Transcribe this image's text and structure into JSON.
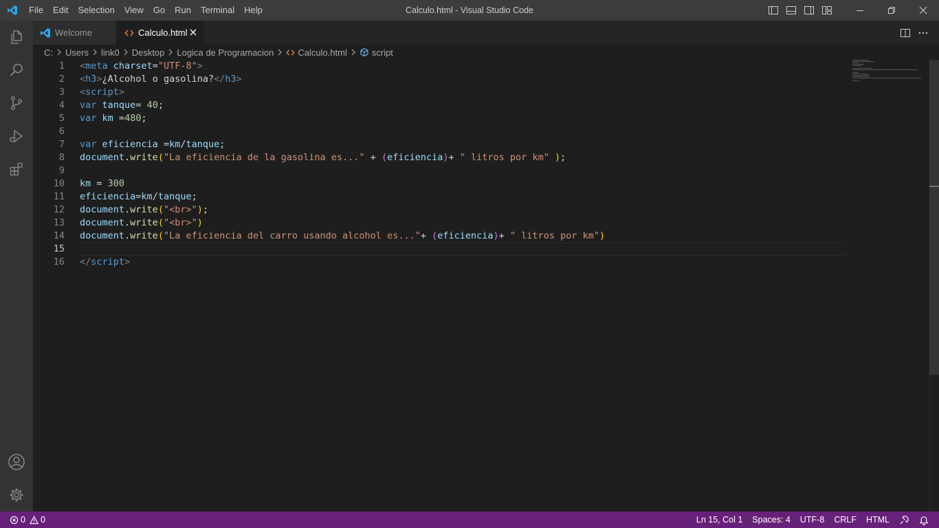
{
  "window": {
    "title": "Calculo.html - Visual Studio Code",
    "menu": [
      "File",
      "Edit",
      "Selection",
      "View",
      "Go",
      "Run",
      "Terminal",
      "Help"
    ]
  },
  "tabs": [
    {
      "label": "Welcome",
      "icon": "vscode-logo-icon",
      "active": false
    },
    {
      "label": "Calculo.html",
      "icon": "html-file-icon",
      "active": true
    }
  ],
  "breadcrumb": [
    "C:",
    "Users",
    "link0",
    "Desktop",
    "Logica de Programacion",
    "Calculo.html",
    "script"
  ],
  "editor": {
    "current_line": 15,
    "line_numbers": [
      "1",
      "2",
      "3",
      "4",
      "5",
      "6",
      "7",
      "8",
      "9",
      "10",
      "11",
      "12",
      "13",
      "14",
      "15",
      "16"
    ]
  },
  "statusbar": {
    "errors": "0",
    "warnings": "0",
    "position": "Ln 15, Col 1",
    "spaces": "Spaces: 4",
    "encoding": "UTF-8",
    "eol": "CRLF",
    "language": "HTML"
  },
  "colors": {
    "statusbar_bg": "#68217a",
    "titlebar_bg": "#3c3c3c",
    "activitybar_bg": "#333333",
    "editor_bg": "#1e1e1e",
    "accent_blue": "#007acc"
  },
  "code_lines": [
    [
      [
        "t-tag",
        "<"
      ],
      [
        "t-tname",
        "meta"
      ],
      [
        "t-text",
        " "
      ],
      [
        "t-attr",
        "charset"
      ],
      [
        "t-text",
        "="
      ],
      [
        "t-str",
        "\"UTF-8\""
      ],
      [
        "t-tag",
        ">"
      ]
    ],
    [
      [
        "t-tag",
        "<"
      ],
      [
        "t-tname",
        "h3"
      ],
      [
        "t-tag",
        ">"
      ],
      [
        "t-text",
        "¿Alcohol o gasolina?"
      ],
      [
        "t-tag",
        "</"
      ],
      [
        "t-tname",
        "h3"
      ],
      [
        "t-tag",
        ">"
      ]
    ],
    [
      [
        "t-tag",
        "<"
      ],
      [
        "t-tname",
        "script"
      ],
      [
        "t-tag",
        ">"
      ]
    ],
    [
      [
        "t-kw",
        "var"
      ],
      [
        "t-text",
        " "
      ],
      [
        "t-var",
        "tanque"
      ],
      [
        "t-text",
        "= "
      ],
      [
        "t-num",
        "40"
      ],
      [
        "t-text",
        ";"
      ]
    ],
    [
      [
        "t-kw",
        "var"
      ],
      [
        "t-text",
        " "
      ],
      [
        "t-var",
        "km"
      ],
      [
        "t-text",
        " ="
      ],
      [
        "t-num",
        "480"
      ],
      [
        "t-text",
        ";"
      ]
    ],
    [],
    [
      [
        "t-kw",
        "var"
      ],
      [
        "t-text",
        " "
      ],
      [
        "t-var",
        "eficiencia"
      ],
      [
        "t-text",
        " ="
      ],
      [
        "t-var",
        "km"
      ],
      [
        "t-text",
        "/"
      ],
      [
        "t-var",
        "tanque"
      ],
      [
        "t-text",
        ";"
      ]
    ],
    [
      [
        "t-var",
        "document"
      ],
      [
        "t-text",
        "."
      ],
      [
        "t-fn",
        "write"
      ],
      [
        "t-p1",
        "("
      ],
      [
        "t-str",
        "\"La eficiencia de la gasolina es...\""
      ],
      [
        "t-text",
        " + "
      ],
      [
        "t-p2",
        "("
      ],
      [
        "t-var",
        "eficiencia"
      ],
      [
        "t-p2",
        ")"
      ],
      [
        "t-text",
        "+ "
      ],
      [
        "t-str",
        "\" litros por km\""
      ],
      [
        "t-text",
        " "
      ],
      [
        "t-p1",
        ")"
      ],
      [
        "t-text",
        ";"
      ]
    ],
    [],
    [
      [
        "t-var",
        "km"
      ],
      [
        "t-text",
        " = "
      ],
      [
        "t-num",
        "300"
      ]
    ],
    [
      [
        "t-var",
        "eficiencia"
      ],
      [
        "t-text",
        "="
      ],
      [
        "t-var",
        "km"
      ],
      [
        "t-text",
        "/"
      ],
      [
        "t-var",
        "tanque"
      ],
      [
        "t-text",
        ";"
      ]
    ],
    [
      [
        "t-var",
        "document"
      ],
      [
        "t-text",
        "."
      ],
      [
        "t-fn",
        "write"
      ],
      [
        "t-p1",
        "("
      ],
      [
        "t-str",
        "\"<br>\""
      ],
      [
        "t-p1",
        ")"
      ],
      [
        "t-text",
        ";"
      ]
    ],
    [
      [
        "t-var",
        "document"
      ],
      [
        "t-text",
        "."
      ],
      [
        "t-fn",
        "write"
      ],
      [
        "t-p1",
        "("
      ],
      [
        "t-str",
        "\"<br>\""
      ],
      [
        "t-p1",
        ")"
      ]
    ],
    [
      [
        "t-var",
        "document"
      ],
      [
        "t-text",
        "."
      ],
      [
        "t-fn",
        "write"
      ],
      [
        "t-p1",
        "("
      ],
      [
        "t-str",
        "\"La eficiencia del carro usando alcohol es...\""
      ],
      [
        "t-text",
        "+ "
      ],
      [
        "t-p2",
        "("
      ],
      [
        "t-var",
        "eficiencia"
      ],
      [
        "t-p2",
        ")"
      ],
      [
        "t-text",
        "+ "
      ],
      [
        "t-str",
        "\" litros por km\""
      ],
      [
        "t-p1",
        ")"
      ]
    ],
    [],
    [
      [
        "t-tag",
        "</"
      ],
      [
        "t-tname",
        "script"
      ],
      [
        "t-tag",
        ">"
      ]
    ]
  ]
}
